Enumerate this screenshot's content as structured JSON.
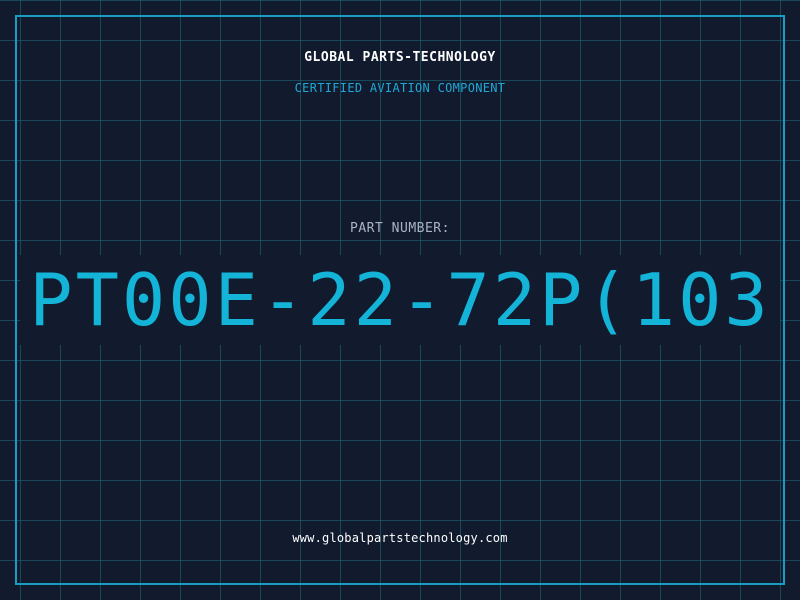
{
  "header": {
    "company": "GLOBAL PARTS-TECHNOLOGY",
    "tagline": "CERTIFIED AVIATION COMPONENT"
  },
  "part": {
    "label": "PART NUMBER:",
    "value": "PT00E-22-72P(103"
  },
  "footer": {
    "website": "www.globalpartstechnology.com"
  },
  "colors": {
    "background": "#121a2e",
    "grid": "#1e6e82",
    "frame": "#1b9dc2",
    "accent": "#13b4d8",
    "label": "#aab4c4",
    "text": "#ffffff"
  }
}
